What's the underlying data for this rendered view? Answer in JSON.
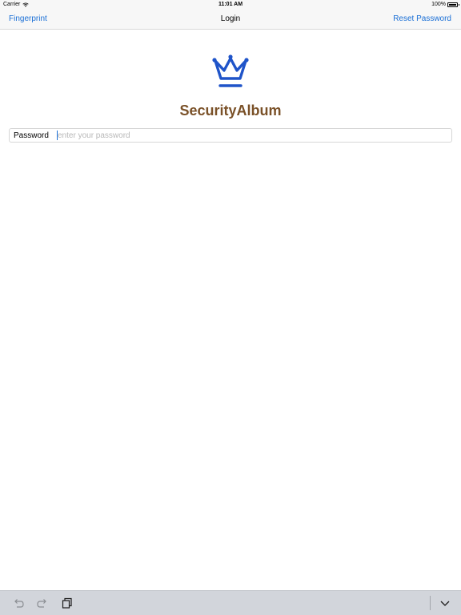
{
  "status_bar": {
    "carrier": "Carrier",
    "time": "11:01 AM",
    "battery": "100%"
  },
  "nav_bar": {
    "left_button": "Fingerprint",
    "title": "Login",
    "right_button": "Reset Password"
  },
  "app": {
    "logo_icon": "crown-icon",
    "name": "SecurityAlbum",
    "name_color": "#7a5128",
    "logo_color": "#1f54c9"
  },
  "login_form": {
    "password_label": "Password",
    "password_placeholder": "enter your password",
    "password_value": ""
  },
  "keyboard_toolbar": {
    "undo_icon": "undo-icon",
    "redo_icon": "redo-icon",
    "paste_icon": "clipboard-icon",
    "dismiss_icon": "chevron-down-icon"
  },
  "colors": {
    "tint": "#1a6fd6",
    "toolbar_bg": "#d2d5db"
  }
}
